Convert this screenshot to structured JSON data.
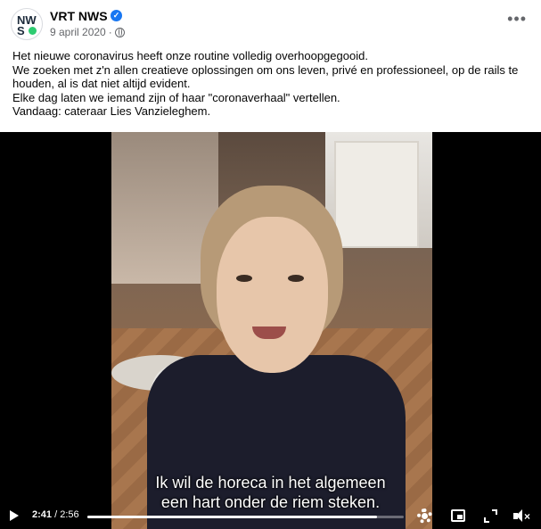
{
  "post": {
    "page_name": "VRT NWS",
    "avatar_text": [
      "NW",
      "S"
    ],
    "date": "9 april 2020",
    "separator": "·",
    "more_label": "•••",
    "text_lines": [
      "Het nieuwe coronavirus heeft onze routine volledig overhoopgegooid.",
      "We zoeken met z'n allen creatieve oplossingen om ons leven, privé en professioneel, op de rails te houden, al is dat niet altijd evident.",
      "Elke dag laten we iemand zijn of haar \"coronaverhaal\" vertellen.",
      "Vandaag: cateraar Lies Vanzieleghem."
    ]
  },
  "video": {
    "subtitle_lines": [
      "Ik wil de horeca in het algemeen",
      "een hart onder de riem steken."
    ],
    "current_time": "2:41",
    "total_time": "2:56",
    "time_separator": "/",
    "progress_fraction": 0.915
  },
  "colors": {
    "verified": "#1877f2",
    "meta_text": "#65676b",
    "avatar_dot": "#2ecc71"
  },
  "icons": [
    "verified-badge-icon",
    "globe-icon",
    "more-icon",
    "play-icon",
    "gear-icon",
    "pip-icon",
    "fullscreen-icon",
    "volume-muted-icon"
  ]
}
